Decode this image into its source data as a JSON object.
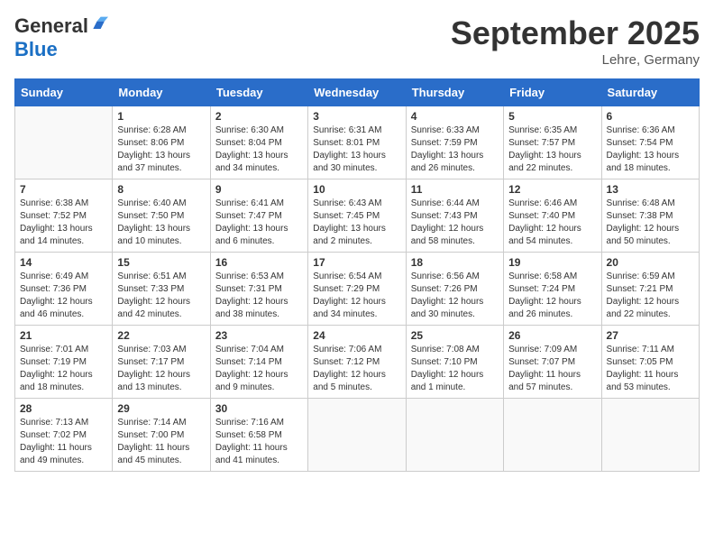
{
  "header": {
    "logo": {
      "general": "General",
      "blue": "Blue"
    },
    "title": "September 2025",
    "location": "Lehre, Germany"
  },
  "calendar": {
    "days_of_week": [
      "Sunday",
      "Monday",
      "Tuesday",
      "Wednesday",
      "Thursday",
      "Friday",
      "Saturday"
    ],
    "weeks": [
      [
        {
          "day": "",
          "info": ""
        },
        {
          "day": "1",
          "info": "Sunrise: 6:28 AM\nSunset: 8:06 PM\nDaylight: 13 hours\nand 37 minutes."
        },
        {
          "day": "2",
          "info": "Sunrise: 6:30 AM\nSunset: 8:04 PM\nDaylight: 13 hours\nand 34 minutes."
        },
        {
          "day": "3",
          "info": "Sunrise: 6:31 AM\nSunset: 8:01 PM\nDaylight: 13 hours\nand 30 minutes."
        },
        {
          "day": "4",
          "info": "Sunrise: 6:33 AM\nSunset: 7:59 PM\nDaylight: 13 hours\nand 26 minutes."
        },
        {
          "day": "5",
          "info": "Sunrise: 6:35 AM\nSunset: 7:57 PM\nDaylight: 13 hours\nand 22 minutes."
        },
        {
          "day": "6",
          "info": "Sunrise: 6:36 AM\nSunset: 7:54 PM\nDaylight: 13 hours\nand 18 minutes."
        }
      ],
      [
        {
          "day": "7",
          "info": "Sunrise: 6:38 AM\nSunset: 7:52 PM\nDaylight: 13 hours\nand 14 minutes."
        },
        {
          "day": "8",
          "info": "Sunrise: 6:40 AM\nSunset: 7:50 PM\nDaylight: 13 hours\nand 10 minutes."
        },
        {
          "day": "9",
          "info": "Sunrise: 6:41 AM\nSunset: 7:47 PM\nDaylight: 13 hours\nand 6 minutes."
        },
        {
          "day": "10",
          "info": "Sunrise: 6:43 AM\nSunset: 7:45 PM\nDaylight: 13 hours\nand 2 minutes."
        },
        {
          "day": "11",
          "info": "Sunrise: 6:44 AM\nSunset: 7:43 PM\nDaylight: 12 hours\nand 58 minutes."
        },
        {
          "day": "12",
          "info": "Sunrise: 6:46 AM\nSunset: 7:40 PM\nDaylight: 12 hours\nand 54 minutes."
        },
        {
          "day": "13",
          "info": "Sunrise: 6:48 AM\nSunset: 7:38 PM\nDaylight: 12 hours\nand 50 minutes."
        }
      ],
      [
        {
          "day": "14",
          "info": "Sunrise: 6:49 AM\nSunset: 7:36 PM\nDaylight: 12 hours\nand 46 minutes."
        },
        {
          "day": "15",
          "info": "Sunrise: 6:51 AM\nSunset: 7:33 PM\nDaylight: 12 hours\nand 42 minutes."
        },
        {
          "day": "16",
          "info": "Sunrise: 6:53 AM\nSunset: 7:31 PM\nDaylight: 12 hours\nand 38 minutes."
        },
        {
          "day": "17",
          "info": "Sunrise: 6:54 AM\nSunset: 7:29 PM\nDaylight: 12 hours\nand 34 minutes."
        },
        {
          "day": "18",
          "info": "Sunrise: 6:56 AM\nSunset: 7:26 PM\nDaylight: 12 hours\nand 30 minutes."
        },
        {
          "day": "19",
          "info": "Sunrise: 6:58 AM\nSunset: 7:24 PM\nDaylight: 12 hours\nand 26 minutes."
        },
        {
          "day": "20",
          "info": "Sunrise: 6:59 AM\nSunset: 7:21 PM\nDaylight: 12 hours\nand 22 minutes."
        }
      ],
      [
        {
          "day": "21",
          "info": "Sunrise: 7:01 AM\nSunset: 7:19 PM\nDaylight: 12 hours\nand 18 minutes."
        },
        {
          "day": "22",
          "info": "Sunrise: 7:03 AM\nSunset: 7:17 PM\nDaylight: 12 hours\nand 13 minutes."
        },
        {
          "day": "23",
          "info": "Sunrise: 7:04 AM\nSunset: 7:14 PM\nDaylight: 12 hours\nand 9 minutes."
        },
        {
          "day": "24",
          "info": "Sunrise: 7:06 AM\nSunset: 7:12 PM\nDaylight: 12 hours\nand 5 minutes."
        },
        {
          "day": "25",
          "info": "Sunrise: 7:08 AM\nSunset: 7:10 PM\nDaylight: 12 hours\nand 1 minute."
        },
        {
          "day": "26",
          "info": "Sunrise: 7:09 AM\nSunset: 7:07 PM\nDaylight: 11 hours\nand 57 minutes."
        },
        {
          "day": "27",
          "info": "Sunrise: 7:11 AM\nSunset: 7:05 PM\nDaylight: 11 hours\nand 53 minutes."
        }
      ],
      [
        {
          "day": "28",
          "info": "Sunrise: 7:13 AM\nSunset: 7:02 PM\nDaylight: 11 hours\nand 49 minutes."
        },
        {
          "day": "29",
          "info": "Sunrise: 7:14 AM\nSunset: 7:00 PM\nDaylight: 11 hours\nand 45 minutes."
        },
        {
          "day": "30",
          "info": "Sunrise: 7:16 AM\nSunset: 6:58 PM\nDaylight: 11 hours\nand 41 minutes."
        },
        {
          "day": "",
          "info": ""
        },
        {
          "day": "",
          "info": ""
        },
        {
          "day": "",
          "info": ""
        },
        {
          "day": "",
          "info": ""
        }
      ]
    ]
  }
}
